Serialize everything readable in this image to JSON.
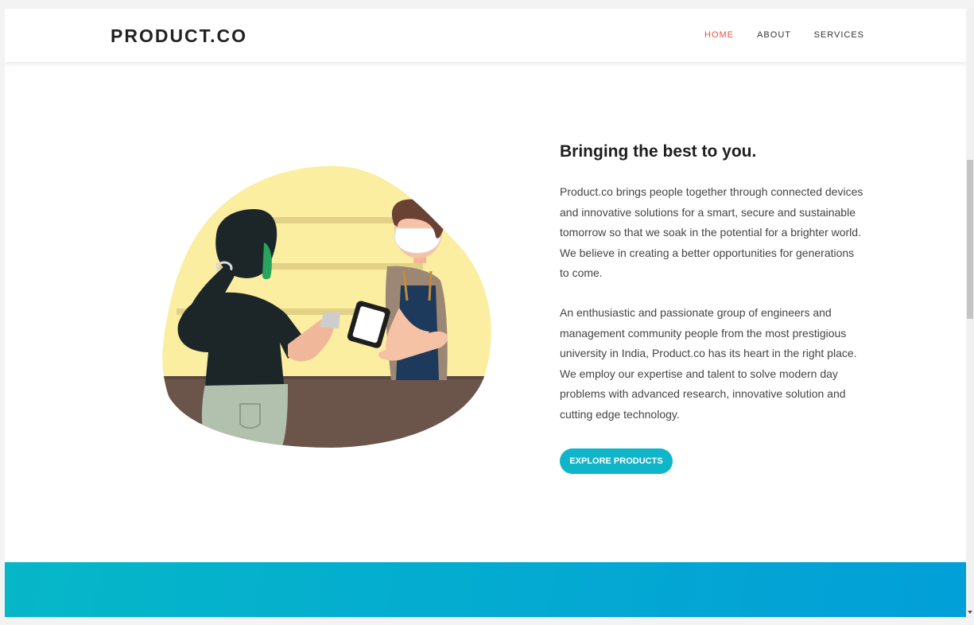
{
  "brand": {
    "name": "PRODUCT.CO"
  },
  "nav": {
    "items": [
      "HOME",
      "ABOUT",
      "SERVICES"
    ],
    "active": "HOME"
  },
  "hero": {
    "heading": "Bringing the best to you.",
    "paragraph1": "Product.co brings people together through connected devices and innovative solutions for a smart, secure and sustainable tomorrow so that we soak in the potential for a brighter world. We believe in creating a better opportunities for generations to come.",
    "paragraph2": "An enthusiastic and passionate group of engineers and management community people from the most prestigious university in India, Product.co has its heart in the right place. We employ our expertise and talent to solve modern day problems with advanced research, innovative solution and cutting edge technology.",
    "cta_label": "EXPLORE PRODUCTS",
    "illustration_icon": "shop-payment-illustration"
  },
  "colors": {
    "accent": "#0fb5c9",
    "nav_active": "#e8534a",
    "band_start": "#06b7c8",
    "band_end": "#029fd8"
  }
}
